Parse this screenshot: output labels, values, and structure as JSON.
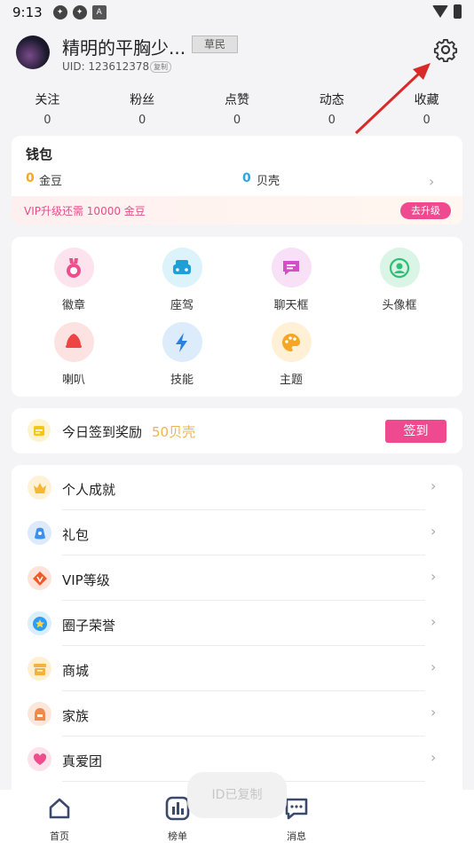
{
  "statusbar": {
    "time": "9:13",
    "icon_a": "A"
  },
  "profile": {
    "username": "精明的平胸少...",
    "rank": "草民",
    "uid": "UID: 123612378",
    "copy": "复制"
  },
  "stats": [
    {
      "label": "关注",
      "value": "0"
    },
    {
      "label": "粉丝",
      "value": "0"
    },
    {
      "label": "点赞",
      "value": "0"
    },
    {
      "label": "动态",
      "value": "0"
    },
    {
      "label": "收藏",
      "value": "0"
    }
  ],
  "wallet": {
    "title": "钱包",
    "coins_value": "0",
    "coins_label": "金豆",
    "shells_value": "0",
    "shells_label": "贝壳",
    "vip_text": "VIP升级还需 10000 金豆",
    "vip_button": "去升级"
  },
  "features": [
    {
      "label": "徽章",
      "icon": "medal-icon"
    },
    {
      "label": "座驾",
      "icon": "car-icon"
    },
    {
      "label": "聊天框",
      "icon": "chat-frame-icon"
    },
    {
      "label": "头像框",
      "icon": "avatar-frame-icon"
    },
    {
      "label": "喇叭",
      "icon": "megaphone-icon"
    },
    {
      "label": "技能",
      "icon": "lightning-icon"
    },
    {
      "label": "主题",
      "icon": "palette-icon"
    }
  ],
  "signin": {
    "text": "今日签到奖励",
    "reward": "50贝壳",
    "button": "签到"
  },
  "menu": [
    {
      "label": "个人成就",
      "icon": "crown-icon",
      "color": "#f7b733"
    },
    {
      "label": "礼包",
      "icon": "gift-bag-icon",
      "color": "#3f8ff0"
    },
    {
      "label": "VIP等级",
      "icon": "vip-icon",
      "color": "#f05a28"
    },
    {
      "label": "圈子荣誉",
      "icon": "honor-icon",
      "color": "#2a9df4"
    },
    {
      "label": "商城",
      "icon": "shop-icon",
      "color": "#f5b041"
    },
    {
      "label": "家族",
      "icon": "family-icon",
      "color": "#f08a4b"
    },
    {
      "label": "真爱团",
      "icon": "heart-group-icon",
      "color": "#ee4f8c"
    }
  ],
  "toast": "ID已复制",
  "tabs": [
    {
      "label": "首页",
      "icon": "home-icon"
    },
    {
      "label": "榜单",
      "icon": "ranking-icon"
    },
    {
      "label": "消息",
      "icon": "message-icon"
    }
  ],
  "colors": {
    "accent": "#ef4a8f",
    "gold": "#f5a623",
    "blue": "#29a8e0",
    "annotation_arrow": "#d92a2a"
  }
}
